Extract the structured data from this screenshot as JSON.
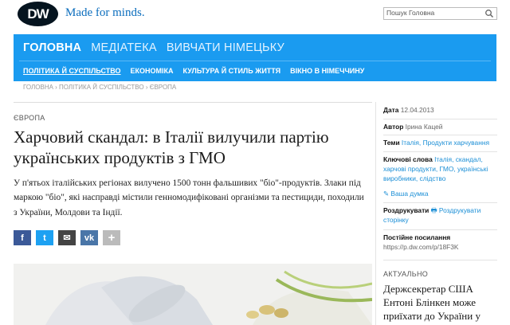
{
  "header": {
    "logo": "DW",
    "tagline": "Made for minds.",
    "search": {
      "placeholder": "Пошук Головна"
    }
  },
  "nav": {
    "main": [
      "ГОЛОВНА",
      "МЕДІАТЕКА",
      "ВИВЧАТИ НІМЕЦЬКУ"
    ],
    "sub": [
      "ПОЛІТИКА Й СУСПІЛЬСТВО",
      "ЕКОНОМІКА",
      "КУЛЬТУРА Й СТИЛЬ ЖИТТЯ",
      "ВІКНО В НІМЕЧЧИНУ"
    ]
  },
  "breadcrumb": [
    "ГОЛОВНА",
    "ПОЛІТИКА Й СУСПІЛЬСТВО",
    "ЄВРОПА"
  ],
  "article": {
    "kicker": "ЄВРОПА",
    "title": "Харчовий скандал: в Італії вилучили партію українських продуктів з ГМО",
    "lead": "У п'ятьох італійських регіонах вилучено 1500 тонн фальшивих \"біо\"-продуктів. Злаки під маркою \"біо\", які насправді містили генномодифіковані організми та пестициди, походили з України, Молдови та Індії.",
    "share": [
      "f",
      "t",
      "✉",
      "vk",
      "+"
    ]
  },
  "sidebar": {
    "date_label": "Дата",
    "date_value": "12.04.2013",
    "author_label": "Автор",
    "author_value": "Ірина Кацей",
    "topics_label": "Теми",
    "topics_value": "Італія, Продукти харчування",
    "keywords_label": "Ключові слова",
    "keywords_value": "Італія, скандал, харчові продукти, ГМО, українські виробники, слідство",
    "feedback": "Ваша думка",
    "print_label": "Роздрукувати",
    "print_link": "Роздрукувати сторінку",
    "permalink_label": "Постійне посилання",
    "permalink_value": "https://p.dw.com/p/18F3K",
    "current_label": "АКТУАЛЬНО",
    "current_headline": "Держсекретар США Ентоні Блінкен може приїхати до України у"
  }
}
